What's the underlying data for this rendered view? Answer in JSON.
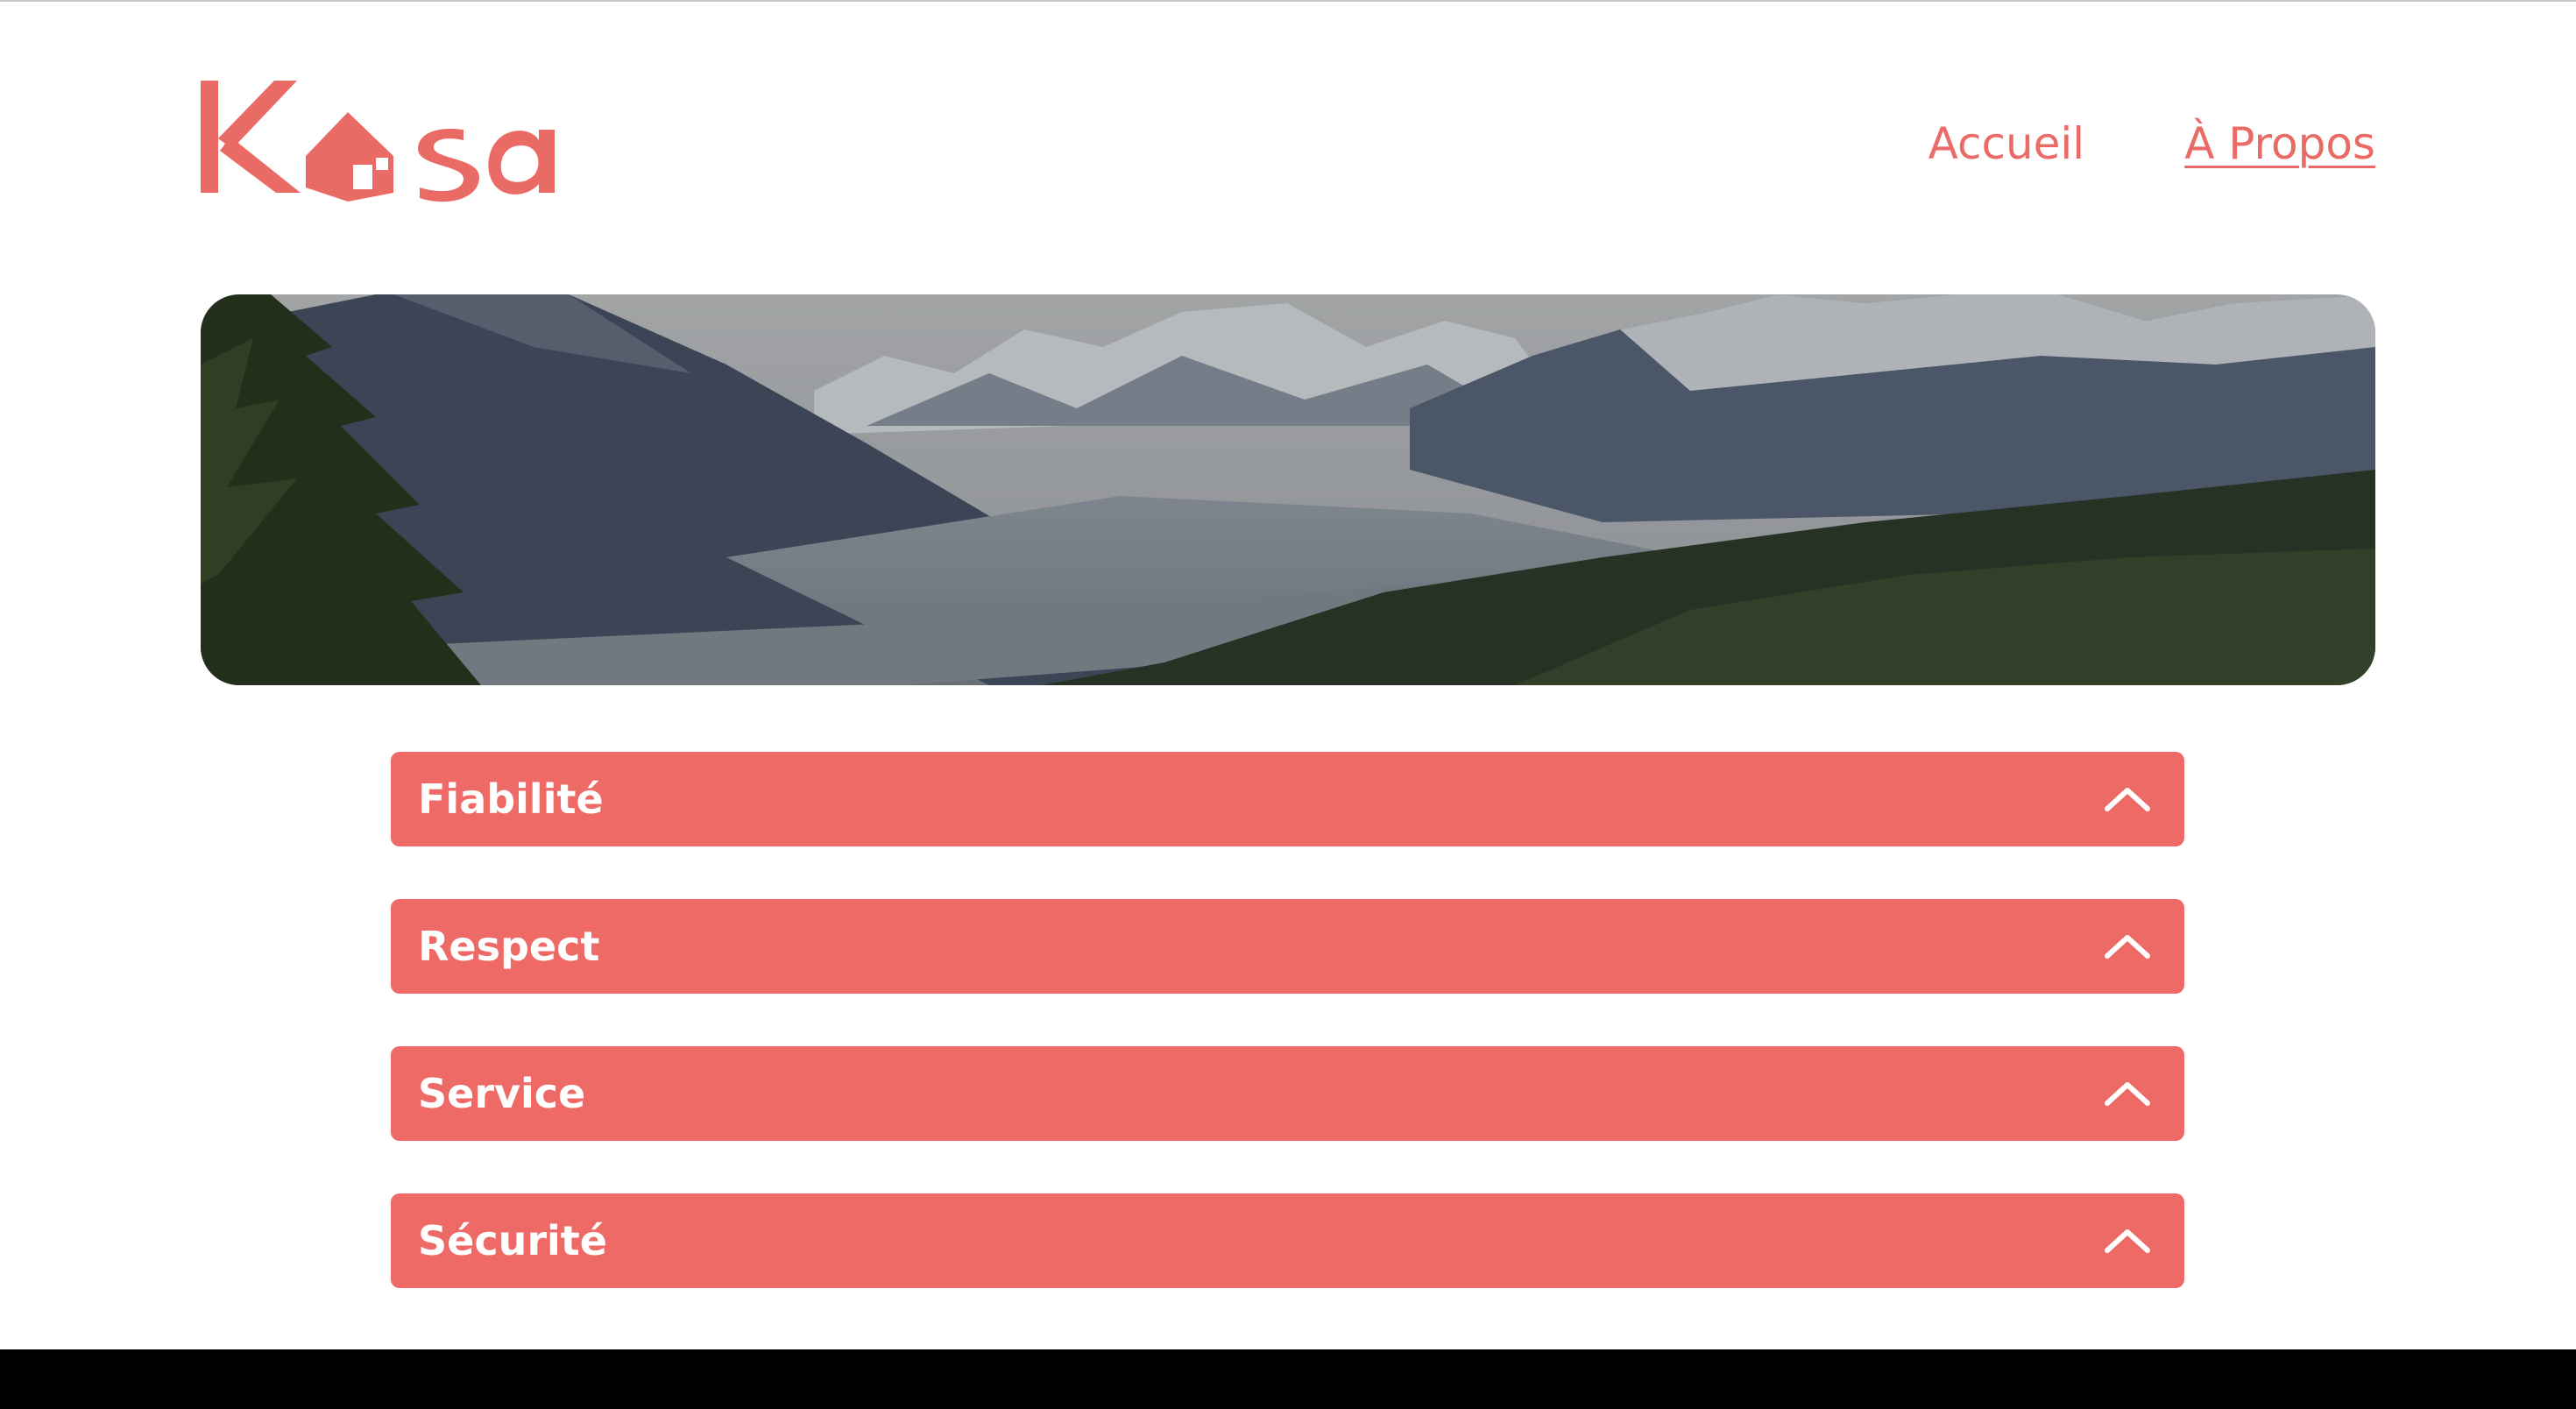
{
  "header": {
    "logo_text": "Kasa",
    "nav": [
      {
        "label": "Accueil",
        "active": false
      },
      {
        "label": "À Propos",
        "active": true
      }
    ]
  },
  "banner": {
    "image": "mountain-landscape"
  },
  "accordion": {
    "items": [
      {
        "title": "Fiabilité",
        "icon": "chevron-up-icon"
      },
      {
        "title": "Respect",
        "icon": "chevron-up-icon"
      },
      {
        "title": "Service",
        "icon": "chevron-up-icon"
      },
      {
        "title": "Sécurité",
        "icon": "chevron-up-icon"
      }
    ]
  },
  "colors": {
    "brand": "#ea6a66",
    "accordion_bg": "#ed6a66",
    "footer": "#000000"
  }
}
